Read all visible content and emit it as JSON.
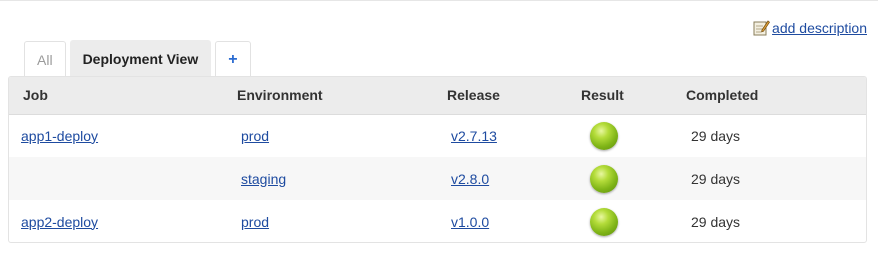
{
  "header": {
    "add_description": "add description",
    "icon": "edit-note-icon"
  },
  "tabs": [
    {
      "label": "All",
      "active": false
    },
    {
      "label": "Deployment View",
      "active": true
    },
    {
      "label": "+",
      "active": false
    }
  ],
  "table": {
    "columns": [
      "Job",
      "Environment",
      "Release",
      "Result",
      "Completed"
    ],
    "rows": [
      {
        "job": "app1-deploy",
        "environment": "prod",
        "release": "v2.7.13",
        "result": "success",
        "completed": "29 days"
      },
      {
        "job": "",
        "environment": "staging",
        "release": "v2.8.0",
        "result": "success",
        "completed": "29 days"
      },
      {
        "job": "app2-deploy",
        "environment": "prod",
        "release": "v1.0.0",
        "result": "success",
        "completed": "29 days"
      }
    ]
  },
  "colors": {
    "link": "#1e4ba0",
    "header_bg": "#ececec",
    "success_ball": "#7fb417",
    "add_tab": "#2a6bd1"
  }
}
